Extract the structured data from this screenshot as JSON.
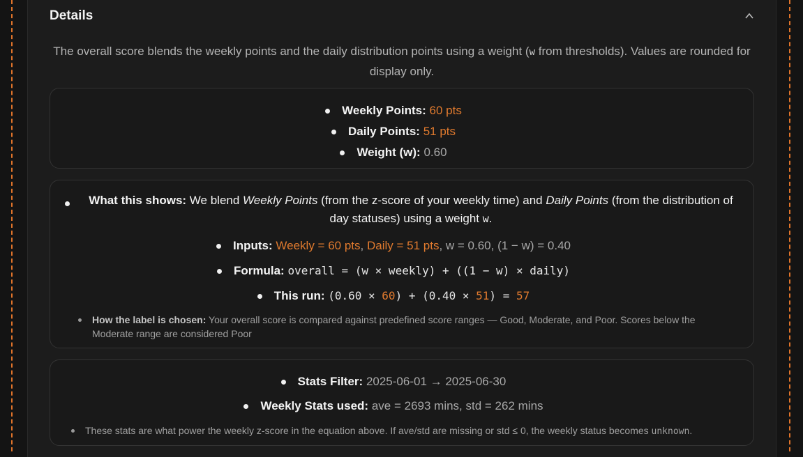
{
  "section": {
    "title": "Details"
  },
  "intro": {
    "before": "The overall score blends the weekly points and the daily distribution points using a weight (",
    "code": "w",
    "after": " from thresholds). Values are rounded for display only."
  },
  "summary": {
    "weekly_label": "Weekly Points:",
    "weekly_value": "60 pts",
    "daily_label": "Daily Points:",
    "daily_value": "51 pts",
    "weight_label": "Weight (w):",
    "weight_value": "0.60"
  },
  "explanation": {
    "what_label": "What this shows:",
    "what_t1": " We blend ",
    "what_i1": "Weekly Points",
    "what_t2": " (from the z-score of your weekly time) and ",
    "what_i2": "Daily Points",
    "what_t3": " (from the distribution of day statuses) using a weight ",
    "what_code": "w",
    "what_end": ".",
    "inputs_label": "Inputs:",
    "inputs_weekly": "Weekly = 60 pts",
    "inputs_sep": ", ",
    "inputs_daily": "Daily = 51 pts",
    "inputs_rest": ", w = 0.60, (1 − w) = 0.40",
    "formula_label": "Formula:",
    "formula_code": "overall = (w × weekly) + ((1 − w) × daily)",
    "run_label": "This run:",
    "run_p1": "(0.60 × ",
    "run_v1": "60",
    "run_p2": ") + (0.40 × ",
    "run_v2": "51",
    "run_p3": ") = ",
    "run_result": "57",
    "label_label": "How the label is chosen:",
    "label_text": " Your overall score is compared against predefined score ranges — Good, Moderate, and Poor. Scores below the Moderate range are considered Poor"
  },
  "stats": {
    "filter_label": "Stats Filter:",
    "filter_value": "2025-06-01 → 2025-06-30",
    "weekly_label": "Weekly Stats used:",
    "weekly_value": "ave = 2693 mins, std = 262 mins",
    "note_text": "These stats are what power the weekly z-score in the equation above. If ave/std are missing or std ≤ 0, the weekly status becomes ",
    "note_code": "unknown",
    "note_end": "."
  },
  "icons": {
    "collapse": "chevron-up-icon"
  },
  "colors": {
    "accent": "#e07a2e",
    "background": "#141414",
    "panel": "#1c1c1c"
  }
}
